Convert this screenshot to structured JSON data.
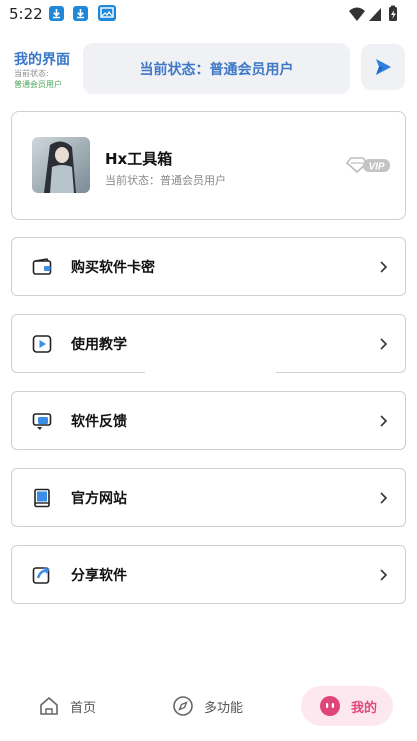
{
  "statusbar": {
    "time": "5:22"
  },
  "header": {
    "title": "我的界面",
    "subtitle_label": "当前状态:",
    "subtitle_value": "普通会员用户",
    "status_text": "当前状态：普通会员用户"
  },
  "profile": {
    "name": "Hx工具箱",
    "status": "当前状态：普通会员用户",
    "badge": "VIP"
  },
  "menu": [
    {
      "label": "购买软件卡密",
      "icon": "wallet-icon"
    },
    {
      "label": "使用教学",
      "icon": "video-play-icon"
    },
    {
      "label": "软件反馈",
      "icon": "feedback-chat-icon"
    },
    {
      "label": "官方网站",
      "icon": "book-icon"
    },
    {
      "label": "分享软件",
      "icon": "share-icon"
    }
  ],
  "nav": {
    "home": "首页",
    "multi": "多功能",
    "mine": "我的"
  },
  "colors": {
    "accent_blue": "#3b78c9",
    "status_green": "#4aa55a",
    "mine_pink": "#e04a7a"
  }
}
